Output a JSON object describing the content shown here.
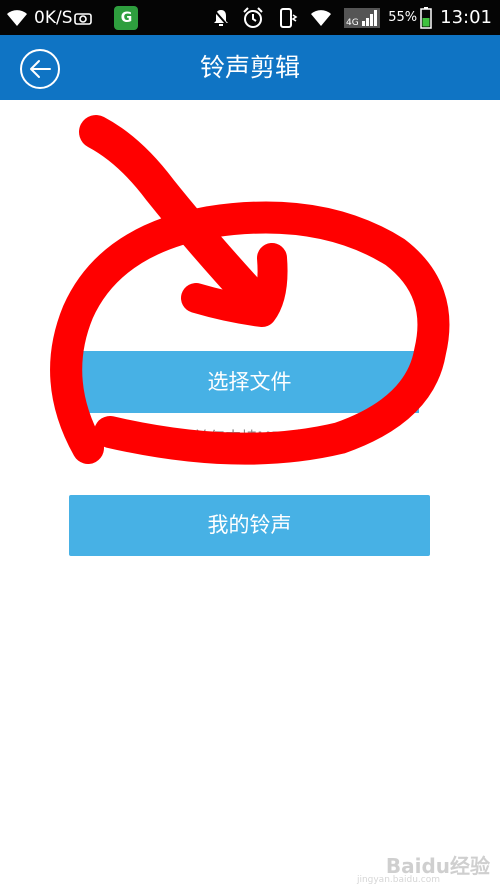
{
  "status_bar": {
    "net_speed": "0K/S",
    "notification_app": "G",
    "network_type": "4G",
    "battery_percent": "55%",
    "time": "13:01",
    "icons": [
      "wifi-icon",
      "camera-icon",
      "notification-app-icon",
      "mute-icon",
      "alarm-icon",
      "phone-vibrate-icon",
      "wifi-icon",
      "signal-icon",
      "battery-icon"
    ]
  },
  "header": {
    "title": "铃声剪辑",
    "back_icon": "back-arrow-icon"
  },
  "main": {
    "select_file_label": "选择文件",
    "hint": "目前仅支持MP3文件",
    "my_ringtone_label": "我的铃声"
  },
  "annotation": {
    "color": "#ff0000",
    "shapes": [
      "arrow",
      "circle"
    ]
  },
  "watermark": {
    "text": "Baidu经验",
    "sub": "jingyan.baidu.com"
  },
  "colors": {
    "status_bar": "#050505",
    "header": "#0f74c4",
    "button": "#47b1e5",
    "hint_text": "#8a8a8a",
    "background": "#ffffff"
  }
}
